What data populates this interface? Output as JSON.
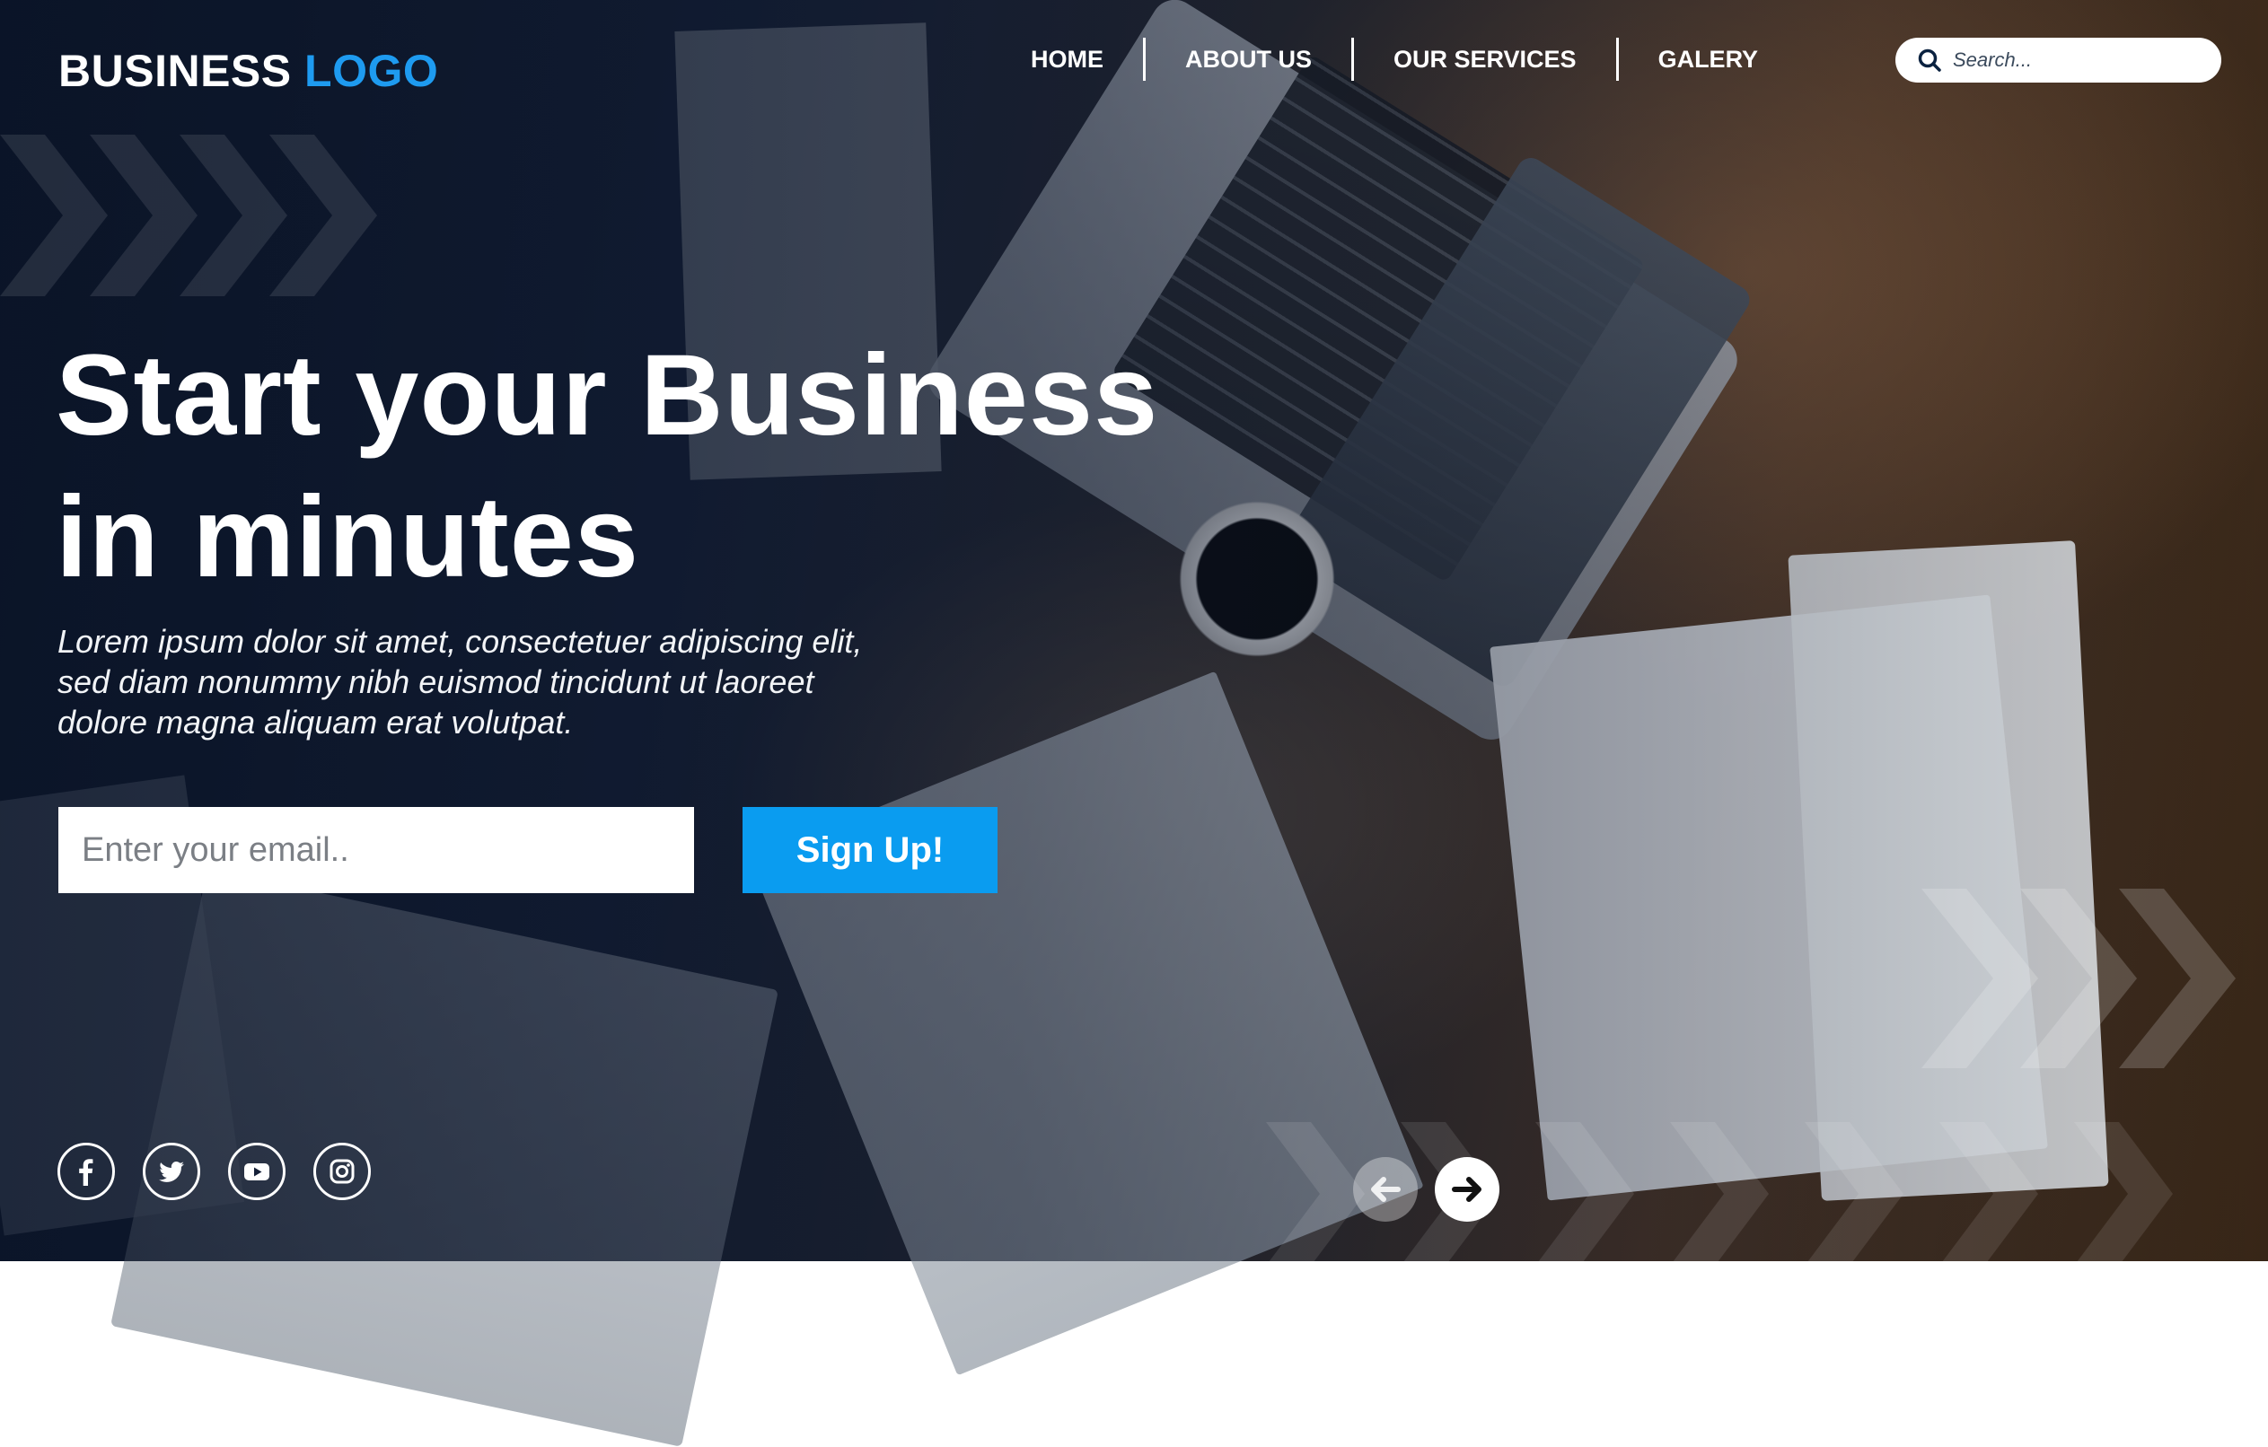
{
  "header": {
    "logo_primary": "BUSINESS",
    "logo_accent": "LOGO",
    "nav": [
      {
        "label": "HOME"
      },
      {
        "label": "ABOUT US"
      },
      {
        "label": "OUR SERVICES"
      },
      {
        "label": "GALERY"
      }
    ],
    "search": {
      "placeholder": "Search...",
      "icon": "search-icon"
    }
  },
  "hero": {
    "headline": [
      "Start your Business",
      "in minutes"
    ],
    "subtext": [
      "Lorem ipsum dolor sit amet, consectetuer adipiscing elit,",
      "sed diam nonummy nibh euismod tincidunt ut laoreet",
      "dolore magna aliquam erat volutpat."
    ],
    "email_placeholder": "Enter your email..",
    "signup_label": "Sign Up!"
  },
  "social": [
    {
      "icon": "facebook-icon"
    },
    {
      "icon": "twitter-icon"
    },
    {
      "icon": "youtube-icon"
    },
    {
      "icon": "instagram-icon"
    }
  ],
  "slider": {
    "prev_icon": "arrow-left-icon",
    "next_icon": "arrow-right-icon"
  },
  "colors": {
    "accent": "#1e9bf0",
    "button": "#0a9cf0",
    "text": "#ffffff"
  }
}
